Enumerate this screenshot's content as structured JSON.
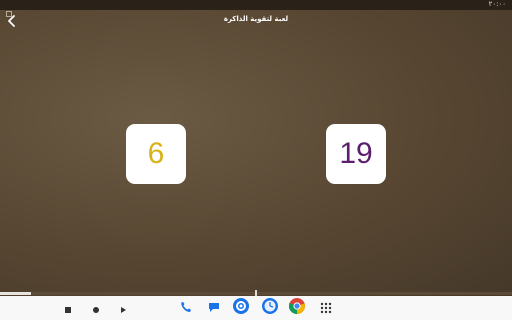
{
  "status_bar": {
    "time": "٢٠:٠٠"
  },
  "top_bar": {
    "title": "لعبة لتقوية الذاكرة",
    "back_icon": "chevron-left-icon"
  },
  "game": {
    "left_card_value": "6",
    "right_card_value": "19",
    "left_color": "#d9b21a",
    "right_color": "#5b1f6e",
    "progress": 0.06
  },
  "nav_bar": {
    "controls": [
      "stop-icon",
      "record-icon",
      "play-icon"
    ],
    "apps": [
      "phone-icon",
      "messages-icon",
      "settings-icon",
      "clock-icon",
      "chrome-icon",
      "app-drawer-icon"
    ]
  },
  "colors": {
    "background": "#574631",
    "card": "#ffffff",
    "accent_blue": "#1a73e8"
  }
}
